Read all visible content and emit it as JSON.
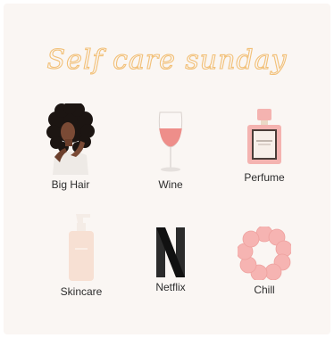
{
  "title": "Self care sunday",
  "items": [
    {
      "label": "Big Hair",
      "icon": "curly-hair-woman-icon"
    },
    {
      "label": "Wine",
      "icon": "wine-glass-icon"
    },
    {
      "label": "Perfume",
      "icon": "perfume-bottle-icon"
    },
    {
      "label": "Skincare",
      "icon": "pump-bottle-icon"
    },
    {
      "label": "Netflix",
      "icon": "netflix-logo-icon"
    },
    {
      "label": "Chill",
      "icon": "scrunchie-icon"
    }
  ],
  "colors": {
    "background": "#faf6f3",
    "title": "#f2c078",
    "label": "#2d2d2d",
    "accent_pink": "#f4b3b0"
  }
}
